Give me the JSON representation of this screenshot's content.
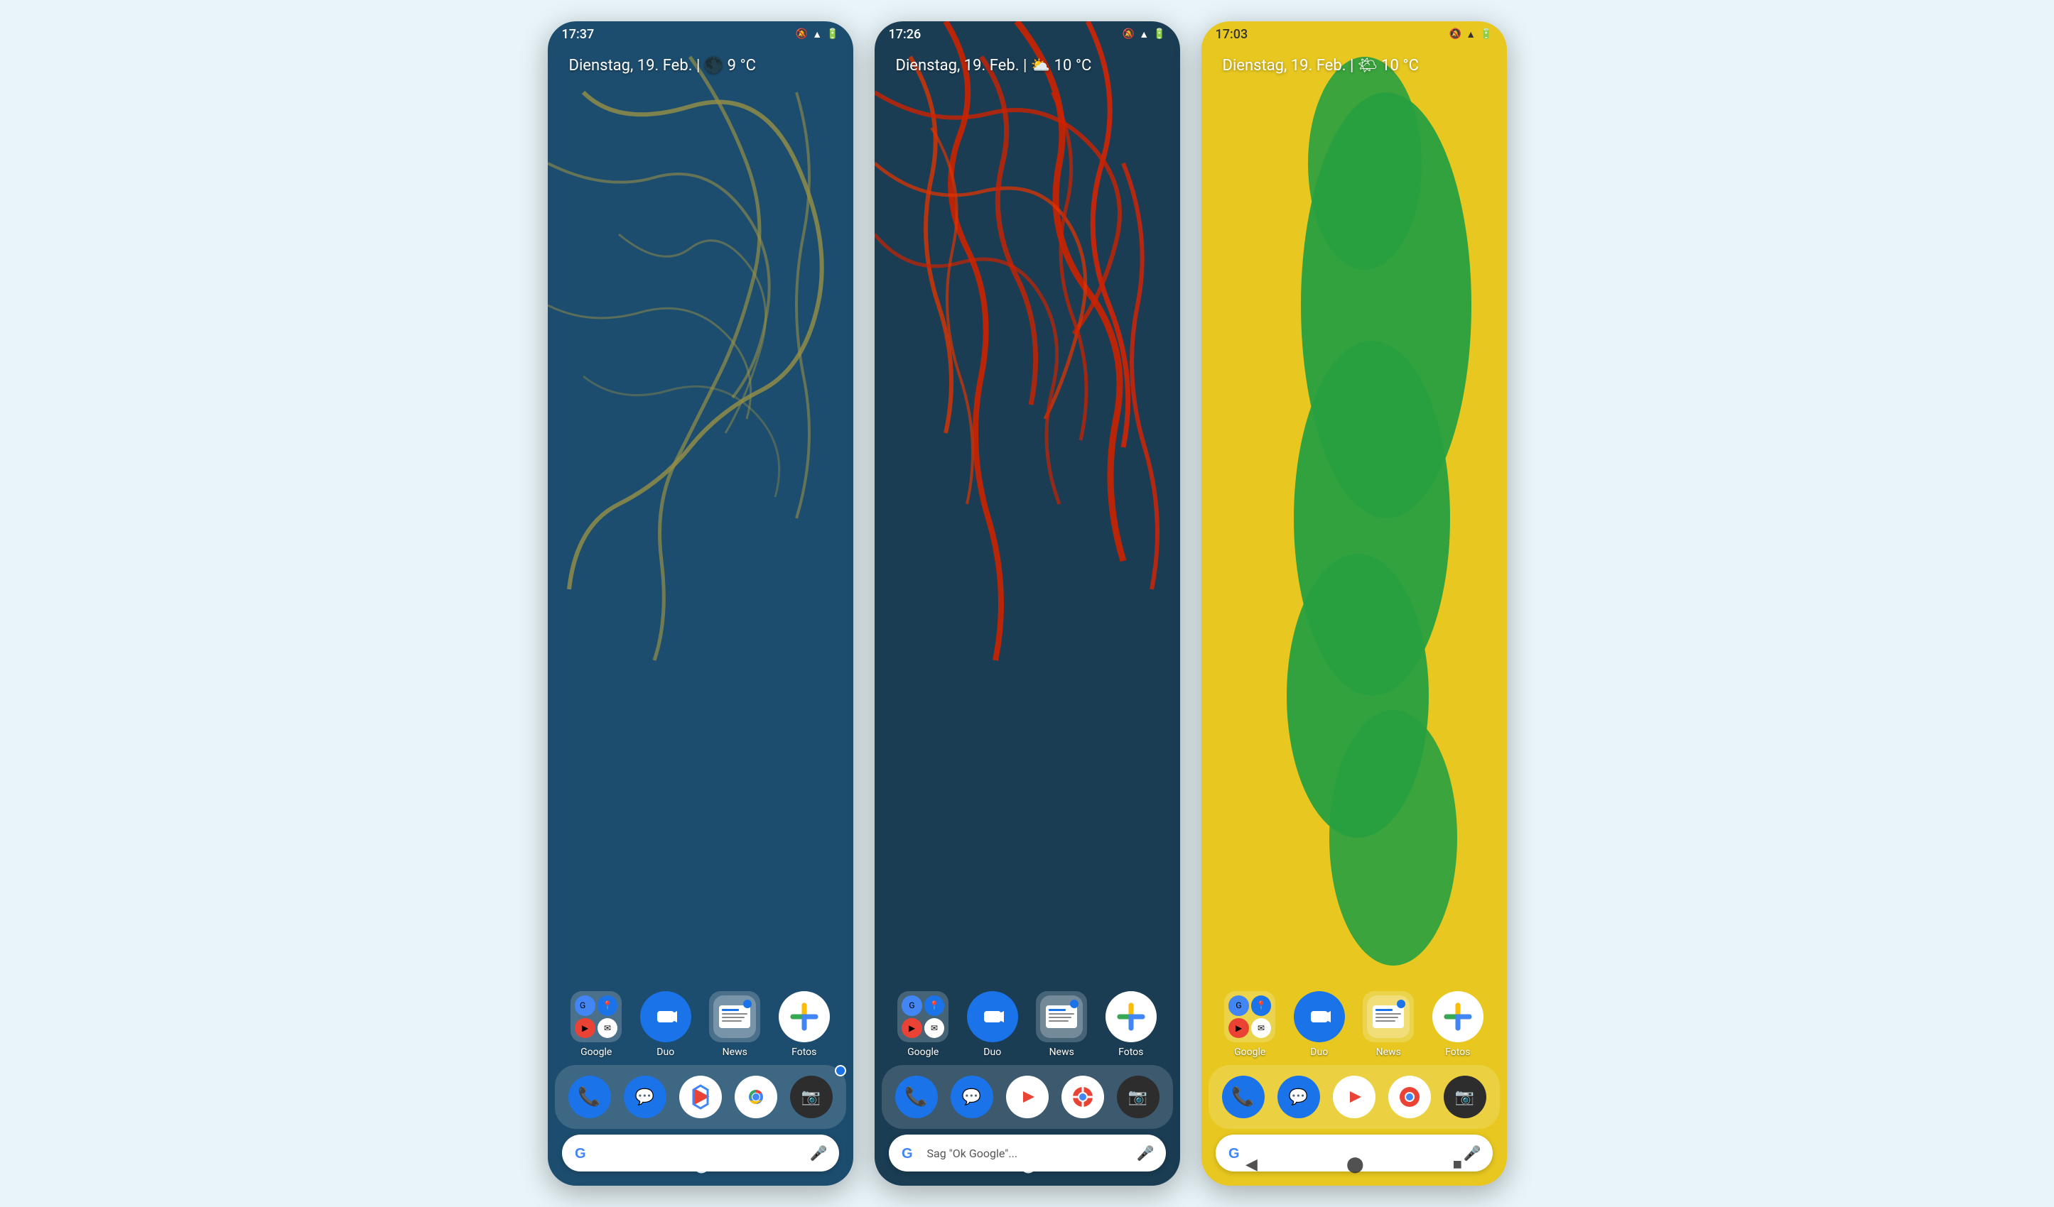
{
  "phones": [
    {
      "id": "phone-1",
      "statusBar": {
        "time": "17:37",
        "icons": [
          "🔕",
          "▲",
          "🔋"
        ]
      },
      "datetime": "Dienstag, 19. Feb. | 🌑 9 °C",
      "wallpaper": "wallpaper-1",
      "appGrid": [
        {
          "name": "Google",
          "type": "google-folder"
        },
        {
          "name": "Duo",
          "type": "duo"
        },
        {
          "name": "News",
          "type": "news-folder"
        },
        {
          "name": "Fotos",
          "type": "photos"
        }
      ],
      "dock": [
        "phone",
        "sms",
        "play",
        "chrome",
        "camera"
      ],
      "searchBar": {
        "placeholder": "",
        "showText": false
      }
    },
    {
      "id": "phone-2",
      "statusBar": {
        "time": "17:26",
        "icons": [
          "🔕",
          "▲",
          "🔋"
        ]
      },
      "datetime": "Dienstag, 19. Feb. | ⛅ 10 °C",
      "wallpaper": "wallpaper-2",
      "appGrid": [
        {
          "name": "Google",
          "type": "google-folder"
        },
        {
          "name": "Duo",
          "type": "duo"
        },
        {
          "name": "News",
          "type": "news-folder"
        },
        {
          "name": "Fotos",
          "type": "photos"
        }
      ],
      "dock": [
        "phone",
        "sms",
        "play",
        "chrome",
        "camera"
      ],
      "searchBar": {
        "placeholder": "Sag \"Ok Google\"...",
        "showText": true
      }
    },
    {
      "id": "phone-3",
      "statusBar": {
        "time": "17:03",
        "icons": [
          "🔕",
          "▲",
          "🔋"
        ]
      },
      "datetime": "Dienstag, 19. Feb. | 🌤 10 °C",
      "wallpaper": "wallpaper-3",
      "appGrid": [
        {
          "name": "Google",
          "type": "google-folder"
        },
        {
          "name": "Duo",
          "type": "duo"
        },
        {
          "name": "News",
          "type": "news-folder"
        },
        {
          "name": "Fotos",
          "type": "photos"
        }
      ],
      "dock": [
        "phone",
        "sms",
        "play",
        "chrome",
        "camera"
      ],
      "searchBar": {
        "placeholder": "",
        "showText": false
      }
    }
  ],
  "nav": {
    "back": "◀",
    "home": "⬤",
    "recent": "■"
  },
  "appLabels": {
    "google": "Google",
    "duo": "Duo",
    "news": "News",
    "fotos": "Fotos"
  },
  "colors": {
    "accent": "#1a73e8",
    "wallpaper1": "#1a4a6b",
    "wallpaper2": "#1a3d54",
    "wallpaper3": "#e8c820",
    "roads1": "#c8a830",
    "roads2": "#cc2200"
  }
}
